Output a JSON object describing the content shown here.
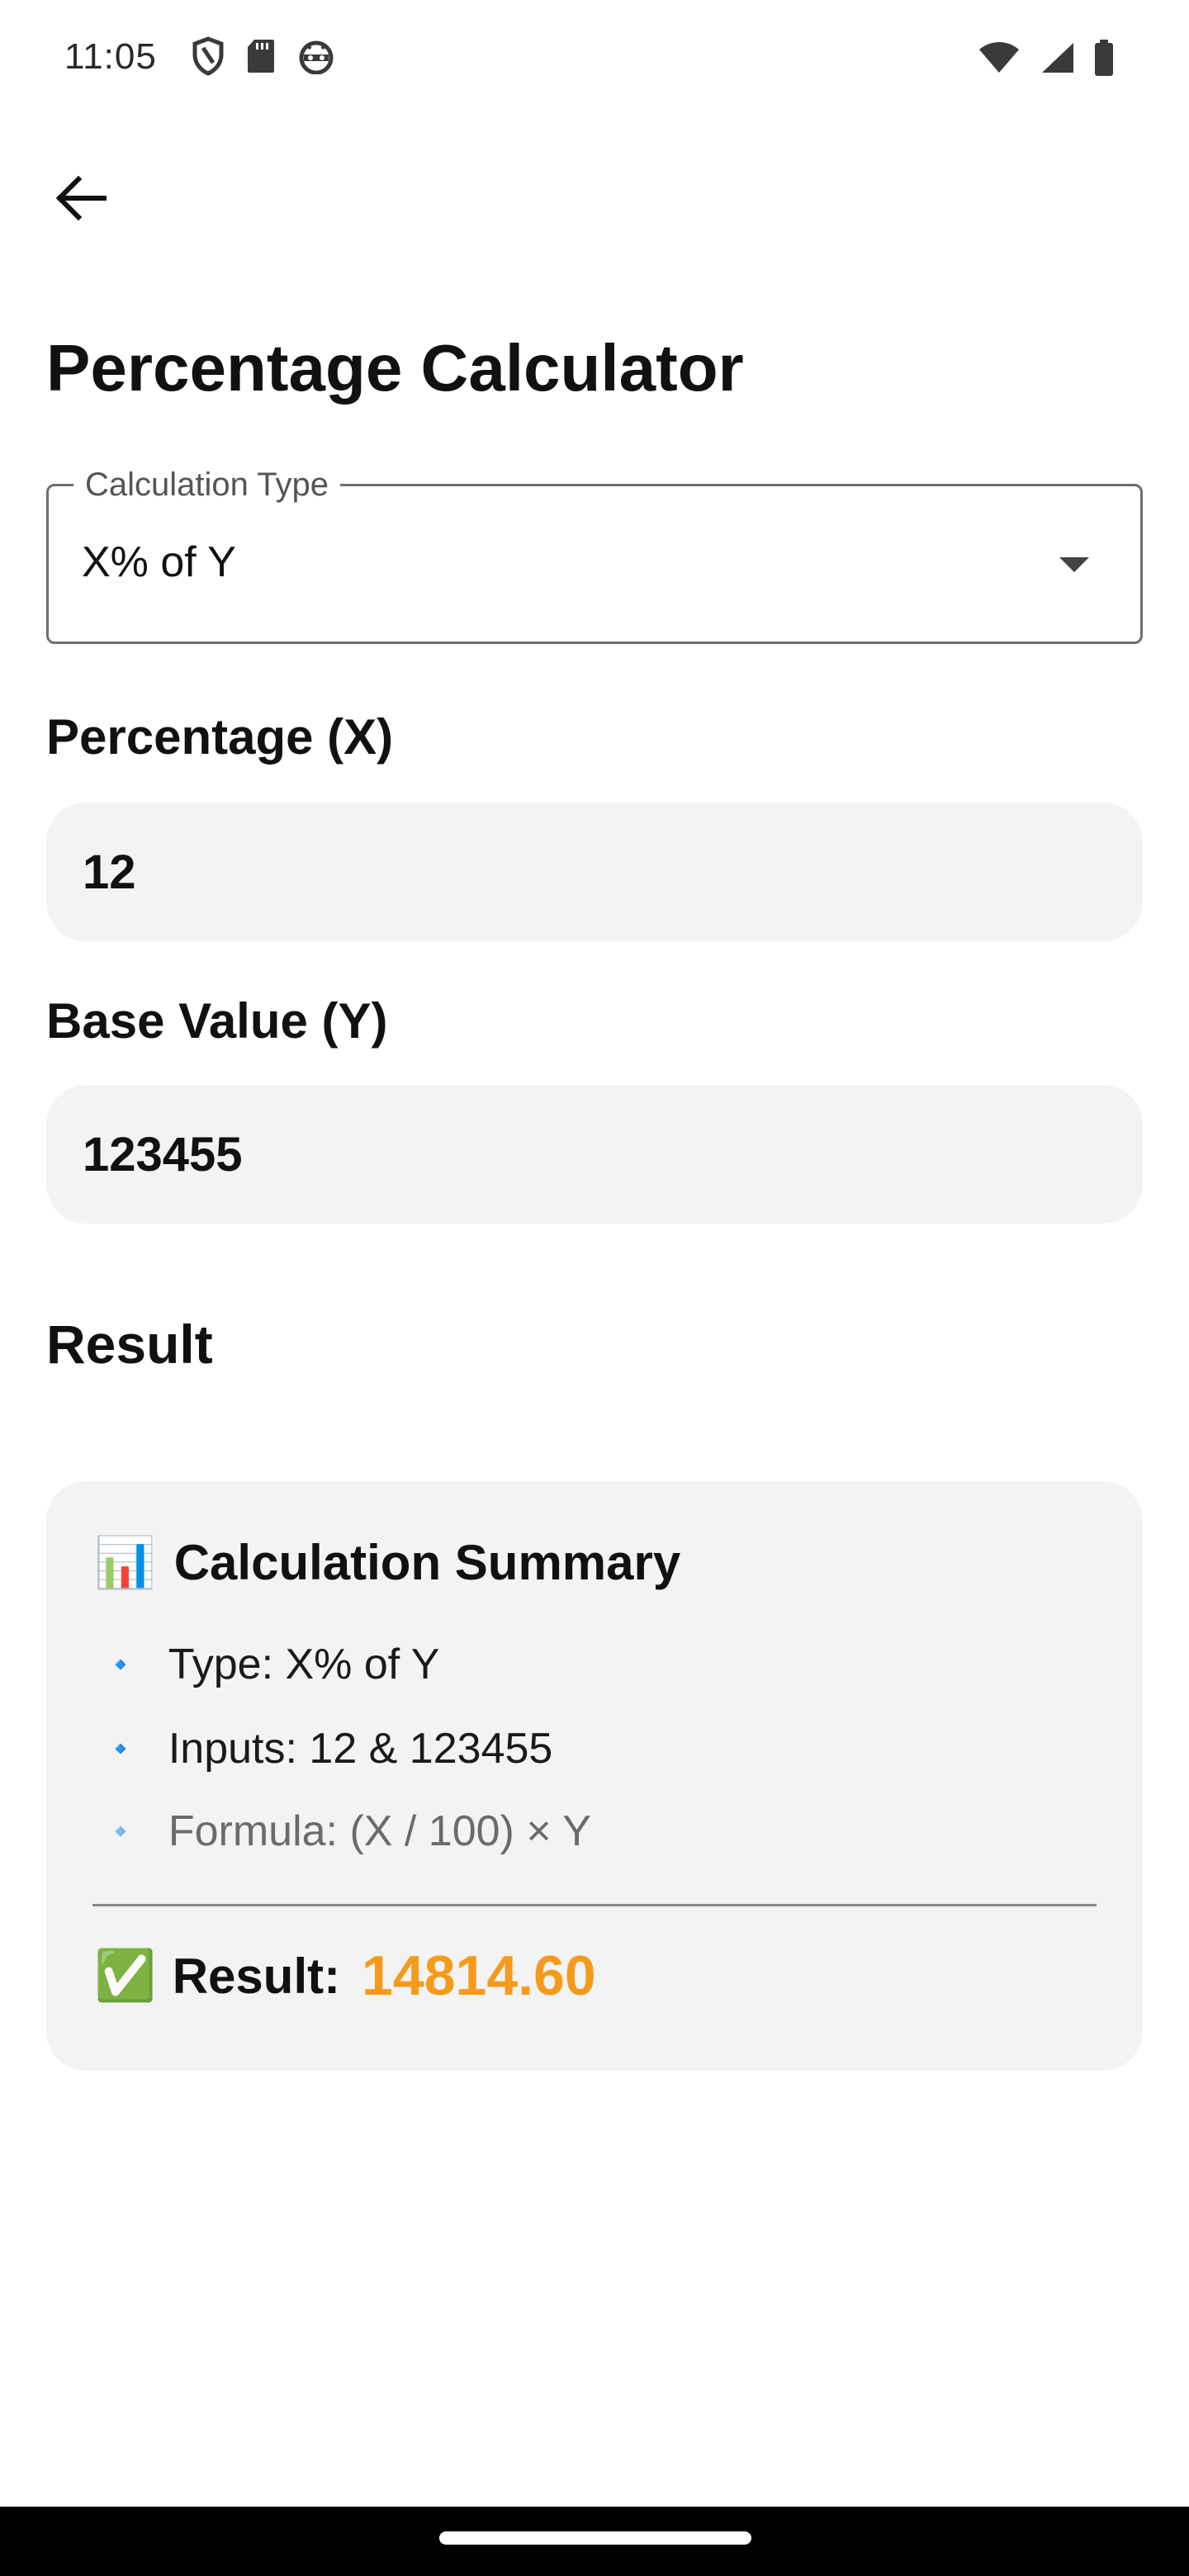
{
  "status_bar": {
    "time": "11:05",
    "left_icons": [
      "shield-icon",
      "sd-card-icon",
      "android-face-icon"
    ],
    "right_icons": [
      "wifi-icon",
      "cell-signal-icon",
      "battery-icon"
    ]
  },
  "app_bar": {
    "back_icon": "arrow-back-icon"
  },
  "page": {
    "title": "Percentage Calculator"
  },
  "calculation_type": {
    "label": "Calculation Type",
    "value": "X% of Y"
  },
  "percentage_field": {
    "label": "Percentage (X)",
    "value": "12"
  },
  "base_field": {
    "label": "Base Value (Y)",
    "value": "123455"
  },
  "result": {
    "heading": "Result"
  },
  "summary": {
    "icon": "📊",
    "title": "Calculation Summary",
    "bullet": "🔹",
    "items": [
      "Type: X% of Y",
      "Inputs: 12 & 123455",
      "Formula: (X / 100) × Y"
    ],
    "result_icon": "✅",
    "result_label": "Result:",
    "result_value": "14814.60"
  },
  "colors": {
    "accent": "#f59a1a",
    "field_bg": "#f3f3f3",
    "outline": "#6f6f6f"
  }
}
